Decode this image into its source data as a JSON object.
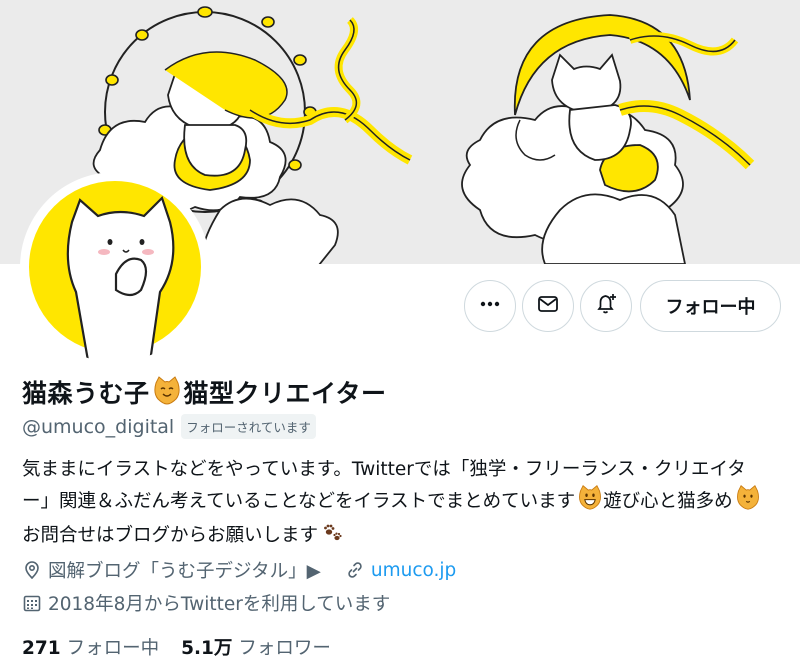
{
  "profile": {
    "name_part1": "猫森うむ子",
    "name_part2": "猫型クリエイター",
    "handle": "@umuco_digital",
    "follows_you": "フォローされています"
  },
  "actions": {
    "more_icon": "more-horizontal-icon",
    "message_icon": "envelope-icon",
    "notify_icon": "bell-plus-icon",
    "follow_label": "フォロー中"
  },
  "bio": {
    "line1": "気ままにイラストなどをやっています。Twitterでは「独学・フリーランス・クリエイタ",
    "line2a": "ー」関連＆ふだん考えていることなどをイラストでまとめています",
    "line2b": " 遊び心と猫多め",
    "line3": "お問合せはブログからお願いします"
  },
  "meta": {
    "location": "図解ブログ「うむ子デジタル」▶",
    "website": "umuco.jp",
    "joined": "2018年8月からTwitterを利用しています"
  },
  "stats": {
    "following_count": "271",
    "following_label": "フォロー中",
    "followers_count": "5.1万",
    "followers_label": "フォロワー"
  },
  "colors": {
    "accent_yellow": "#ffe600",
    "link_blue": "#1d9bf0",
    "muted_gray": "#536471",
    "banner_bg": "#ebebeb"
  }
}
